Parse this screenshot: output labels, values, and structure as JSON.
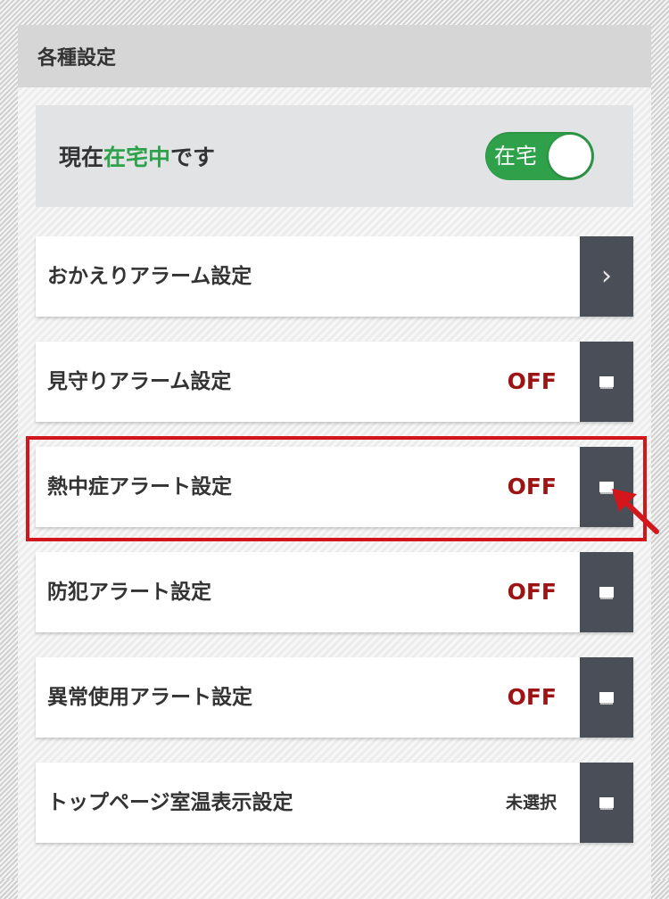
{
  "header": {
    "title": "各種設定"
  },
  "status": {
    "prefix": "現在",
    "highlight": "在宅中",
    "suffix": "です",
    "toggle_label": "在宅",
    "toggle_on": true,
    "highlight_color": "#2ea24a",
    "toggle_color": "#2fa14b"
  },
  "rows": [
    {
      "label": "おかえりアラーム設定",
      "value": "",
      "action": "chevron-right-icon"
    },
    {
      "label": "見守りアラーム設定",
      "value": "OFF",
      "action": "square-icon"
    },
    {
      "label": "熱中症アラート設定",
      "value": "OFF",
      "action": "square-icon"
    },
    {
      "label": "防犯アラート設定",
      "value": "OFF",
      "action": "square-icon"
    },
    {
      "label": "異常使用アラート設定",
      "value": "OFF",
      "action": "square-icon"
    },
    {
      "label": "トップページ室温表示設定",
      "value": "未選択",
      "action": "square-icon"
    }
  ],
  "colors": {
    "off_value": "#9c1414",
    "action_button": "#4a4f57",
    "highlight_border": "#d3161c"
  }
}
